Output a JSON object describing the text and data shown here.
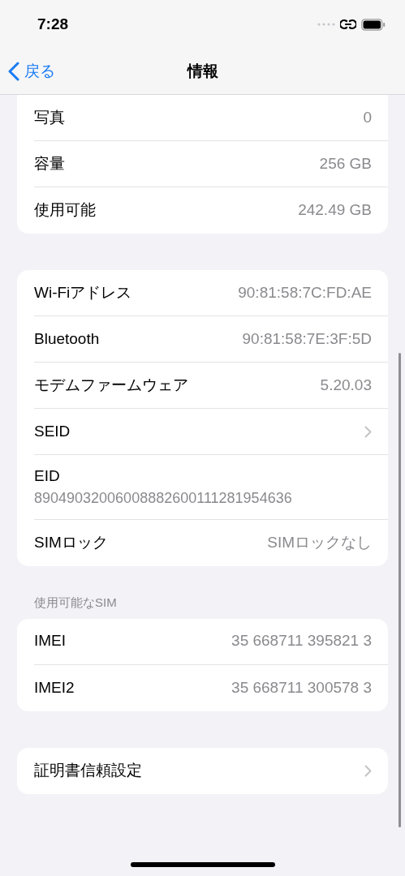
{
  "status_bar": {
    "time": "7:28"
  },
  "nav": {
    "back": "戻る",
    "title": "情報"
  },
  "groups": [
    {
      "cut_top": true,
      "rows": [
        {
          "kind": "value",
          "label": "写真",
          "value": "0"
        },
        {
          "kind": "value",
          "label": "容量",
          "value": "256 GB"
        },
        {
          "kind": "value",
          "label": "使用可能",
          "value": "242.49 GB"
        }
      ]
    },
    {
      "cut_top": false,
      "rows": [
        {
          "kind": "value",
          "label": "Wi-Fiアドレス",
          "value": "90:81:58:7C:FD:AE"
        },
        {
          "kind": "value",
          "label": "Bluetooth",
          "value": "90:81:58:7E:3F:5D"
        },
        {
          "kind": "value",
          "label": "モデムファームウェア",
          "value": "5.20.03"
        },
        {
          "kind": "chevron",
          "label": "SEID"
        },
        {
          "kind": "stacked",
          "label": "EID",
          "value": "89049032006008882600111281954636"
        },
        {
          "kind": "value",
          "label": "SIMロック",
          "value": "SIMロックなし"
        }
      ]
    },
    {
      "cut_top": false,
      "header": "使用可能なSIM",
      "rows": [
        {
          "kind": "value",
          "label": "IMEI",
          "value": "35 668711 395821 3"
        },
        {
          "kind": "value",
          "label": "IMEI2",
          "value": "35 668711 300578 3"
        }
      ]
    },
    {
      "cut_top": false,
      "rows": [
        {
          "kind": "chevron",
          "label": "証明書信頼設定"
        }
      ]
    }
  ]
}
